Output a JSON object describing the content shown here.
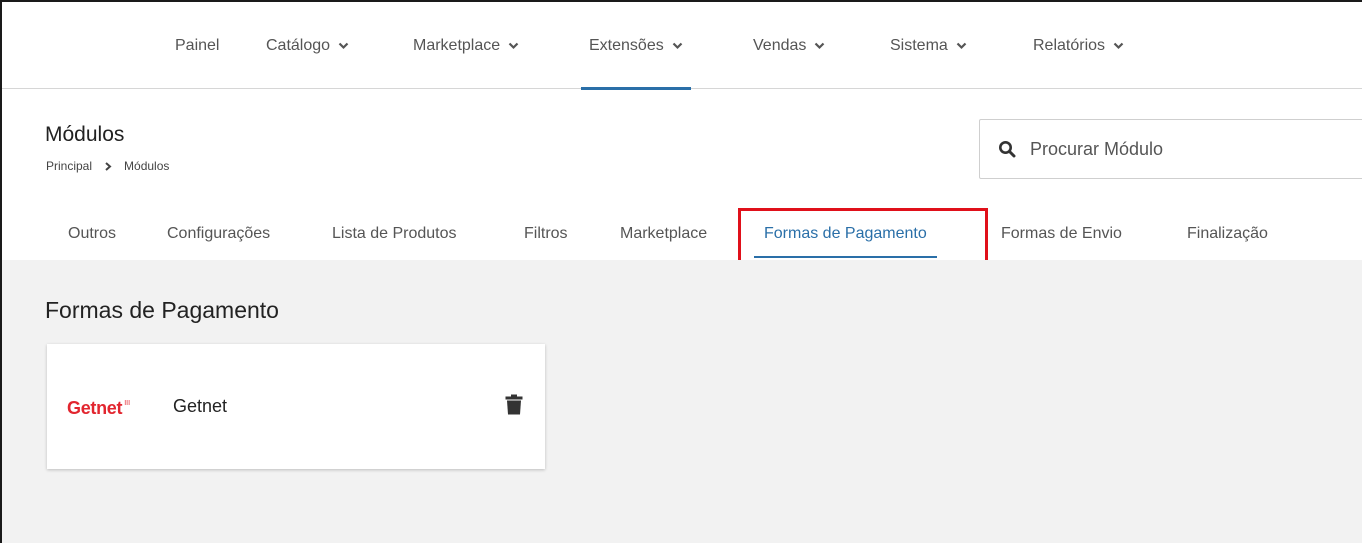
{
  "nav": {
    "items": [
      {
        "label": "Painel",
        "dropdown": false,
        "active": false
      },
      {
        "label": "Catálogo",
        "dropdown": true,
        "active": false
      },
      {
        "label": "Marketplace",
        "dropdown": true,
        "active": false
      },
      {
        "label": "Extensões",
        "dropdown": true,
        "active": true
      },
      {
        "label": "Vendas",
        "dropdown": true,
        "active": false
      },
      {
        "label": "Sistema",
        "dropdown": true,
        "active": false
      },
      {
        "label": "Relatórios",
        "dropdown": true,
        "active": false
      }
    ]
  },
  "header": {
    "title": "Módulos",
    "breadcrumb": [
      "Principal",
      "Módulos"
    ]
  },
  "search": {
    "placeholder": "Procurar Módulo",
    "icon": "search-icon"
  },
  "tabs": [
    {
      "label": "Outros",
      "active": false
    },
    {
      "label": "Configurações",
      "active": false
    },
    {
      "label": "Lista de Produtos",
      "active": false
    },
    {
      "label": "Filtros",
      "active": false
    },
    {
      "label": "Marketplace",
      "active": false
    },
    {
      "label": "Formas de Pagamento",
      "active": true
    },
    {
      "label": "Formas de Envio",
      "active": false
    },
    {
      "label": "Finalização",
      "active": false
    }
  ],
  "section": {
    "title": "Formas de Pagamento"
  },
  "module_card": {
    "logo_text": "Getnet",
    "logo_mark": "III",
    "name": "Getnet",
    "delete_icon": "trash-icon"
  },
  "colors": {
    "accent": "#2a6fa8",
    "highlight": "#e0101a",
    "brand_getnet": "#e2262f",
    "content_bg": "#f2f2f2"
  }
}
